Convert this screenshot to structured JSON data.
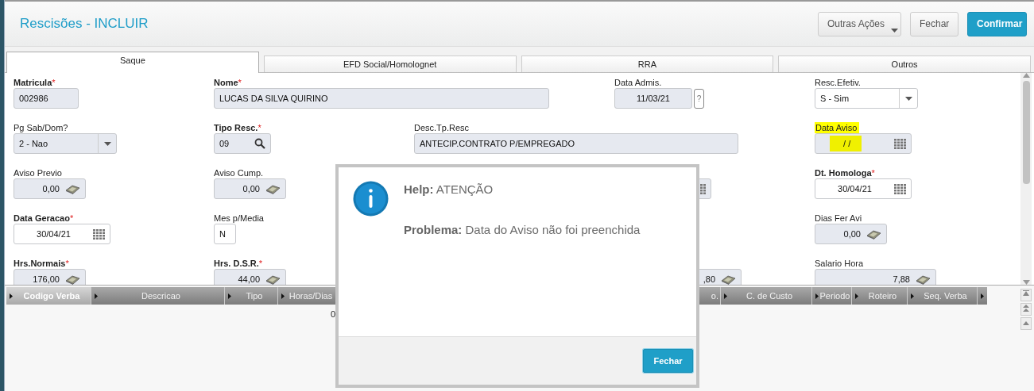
{
  "window": {
    "title": "Rescisões - INCLUIR"
  },
  "toolbar": [
    {
      "label": "Outras Ações",
      "kind": "menu"
    },
    {
      "label": "Fechar",
      "kind": "plain"
    },
    {
      "label": "Confirmar",
      "kind": "primary"
    }
  ],
  "tabs": [
    {
      "label": "Saque",
      "selected": true
    },
    {
      "label": "EFD Social/Homolognet",
      "selected": false
    },
    {
      "label": "RRA",
      "selected": false
    },
    {
      "label": "Outros",
      "selected": false
    }
  ],
  "fields": [
    {
      "label": "Matricula",
      "required": true,
      "required_mark": "*",
      "kind": "text",
      "value": "002986",
      "disabled": true,
      "highlighted": false
    },
    {
      "label": "Nome",
      "required": true,
      "required_mark": "*",
      "kind": "text",
      "value": "LUCAS DA SILVA QUIRINO",
      "disabled": true,
      "highlighted": false
    },
    {
      "label": "Data Admis.",
      "required": false,
      "kind": "help",
      "value": "11/03/21",
      "disabled": true,
      "highlighted": false,
      "help_mark": "?"
    },
    {
      "label": "Resc.Efetiv.",
      "required": false,
      "kind": "select",
      "value": "S - Sim",
      "disabled": false,
      "highlighted": false
    },
    {
      "label": "Pg Sab/Dom?",
      "required": false,
      "kind": "select",
      "value": "2 - Nao",
      "disabled": true,
      "highlighted": false
    },
    {
      "label": "Tipo Resc.",
      "required": true,
      "required_mark": "*",
      "kind": "search",
      "value": "09",
      "disabled": true,
      "highlighted": false
    },
    {
      "label": "Desc.Tp.Resc",
      "required": false,
      "kind": "text",
      "value": "ANTECIP.CONTRATO P/EMPREGADO",
      "disabled": true,
      "highlighted": false
    },
    {
      "label": "Data Aviso",
      "required": false,
      "kind": "date",
      "value": " / /",
      "disabled": true,
      "highlighted": true
    },
    {
      "label": "Aviso Previo",
      "required": false,
      "kind": "money",
      "value": "0,00",
      "disabled": true,
      "highlighted": false
    },
    {
      "label": "Aviso Cump.",
      "required": false,
      "kind": "money",
      "value": "0,00",
      "disabled": true,
      "highlighted": false
    },
    {
      "kind": "date",
      "disabled": true
    },
    {
      "label": "Dt. Homologa",
      "required": true,
      "required_mark": "*",
      "kind": "date",
      "value": "30/04/21",
      "disabled": false,
      "highlighted": false
    },
    {
      "label": "Data Geracao",
      "required": true,
      "required_mark": "*",
      "kind": "date",
      "value": "30/04/21",
      "disabled": false,
      "highlighted": false
    },
    {
      "label": "Mes p/Media",
      "required": false,
      "kind": "text",
      "value": "N",
      "disabled": false,
      "highlighted": false
    },
    {
      "label": "Dias Fer Avi",
      "required": false,
      "kind": "money",
      "value": "0,00",
      "disabled": true,
      "highlighted": false
    },
    {
      "label": "Hrs.Normais",
      "required": true,
      "required_mark": "*",
      "kind": "money",
      "value": "176,00",
      "disabled": true,
      "highlighted": false
    },
    {
      "label": "Hrs. D.S.R.",
      "required": true,
      "required_mark": "*",
      "kind": "money",
      "value": "44,00",
      "disabled": true,
      "highlighted": false
    },
    {
      "kind": "money",
      "value": ",80",
      "disabled": true
    },
    {
      "label": "Salario Hora",
      "required": false,
      "kind": "money",
      "value": "7,88",
      "disabled": true,
      "highlighted": false
    }
  ],
  "grid": {
    "columns": [
      {
        "label": "Codigo Verba",
        "selected": true
      },
      {
        "label": "Descricao",
        "selected": false
      },
      {
        "label": "Tipo",
        "selected": false
      },
      {
        "label": "Horas/Dias",
        "selected": false
      },
      {
        "label": "o.",
        "selected": false
      },
      {
        "label": "C. de Custo",
        "selected": false
      },
      {
        "label": "Periodo",
        "selected": false
      },
      {
        "label": "Roteiro",
        "selected": false
      },
      {
        "label": "Seq. Verba",
        "selected": false
      }
    ],
    "rows": [
      {
        "column_4": "0"
      }
    ]
  },
  "dialog": {
    "heading": "**Help:** ATENÇÃO",
    "message": "**Problema:** Data do Aviso não foi preenchida",
    "button": "Fechar"
  }
}
